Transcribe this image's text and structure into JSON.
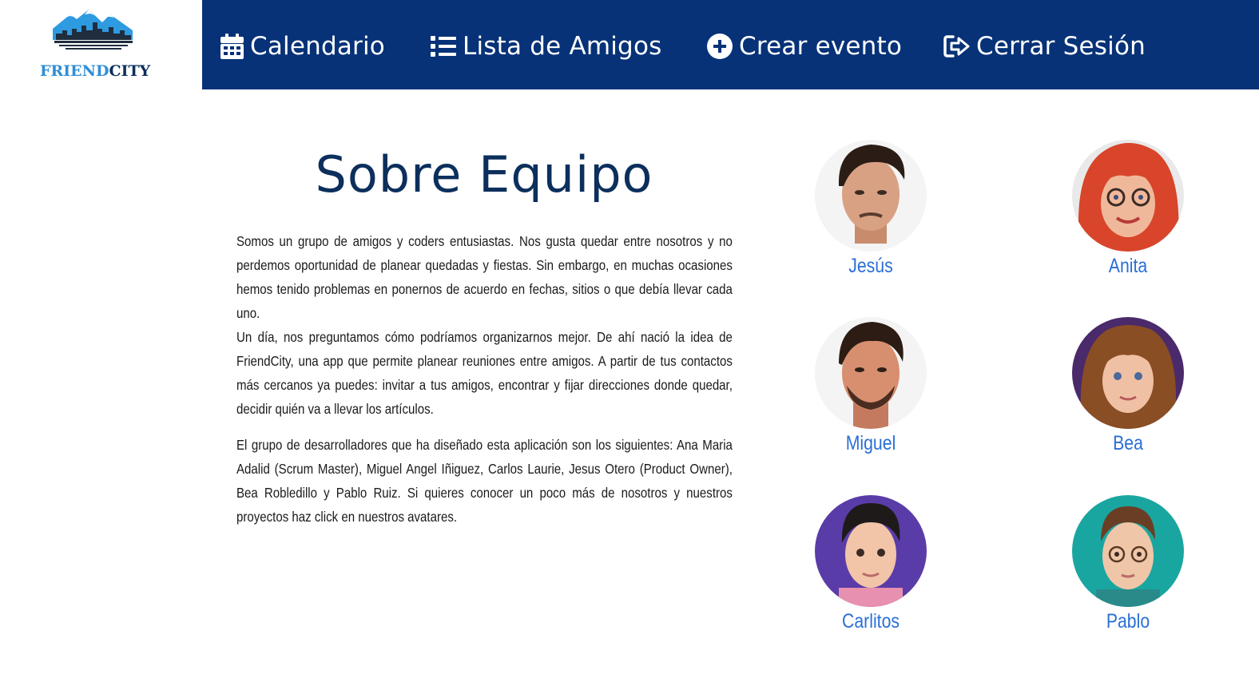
{
  "brand": {
    "part1": "FRIEND",
    "part2": "CITY",
    "accent": "#2e8ed6",
    "dark": "#0c2f5c"
  },
  "nav": {
    "background": "#073278",
    "items": [
      {
        "label": "Calendario",
        "icon": "calendar-icon"
      },
      {
        "label": "Lista de Amigos",
        "icon": "list-icon"
      },
      {
        "label": "Crear evento",
        "icon": "plus-circle-icon"
      },
      {
        "label": "Cerrar Sesión",
        "icon": "sign-out-icon"
      }
    ]
  },
  "about": {
    "title": "Sobre Equipo",
    "paragraphs": [
      "Somos un grupo de amigos y coders entusiastas. Nos gusta quedar entre nosotros y no perdemos oportunidad de planear quedadas y fiestas. Sin embargo, en muchas ocasiones hemos tenido problemas en ponernos de acuerdo en fechas, sitios o que debía llevar cada uno.",
      "Un día, nos preguntamos cómo podríamos organizarnos mejor. De ahí nació la idea de FriendCity, una app que permite planear reuniones entre amigos. A partir de tus contactos más cercanos ya puedes: invitar a tus amigos, encontrar y fijar direcciones donde quedar, decidir quién va a llevar los artículos.",
      "El grupo de desarrolladores que ha diseñado esta aplicación son los siguientes: Ana Maria Adalid (Scrum Master), Miguel Angel Iñiguez, Carlos Laurie, Jesus Otero (Product Owner), Bea Robledillo y Pablo Ruiz. Si quieres conocer un poco más de nosotros y nuestros proyectos haz click en nuestros avatares."
    ]
  },
  "team": [
    {
      "name": "Jesús"
    },
    {
      "name": "Anita"
    },
    {
      "name": "Miguel"
    },
    {
      "name": "Bea"
    },
    {
      "name": "Carlitos"
    },
    {
      "name": "Pablo"
    }
  ],
  "colors": {
    "name_link": "#2a6fd6",
    "title": "#0c2f5c"
  }
}
